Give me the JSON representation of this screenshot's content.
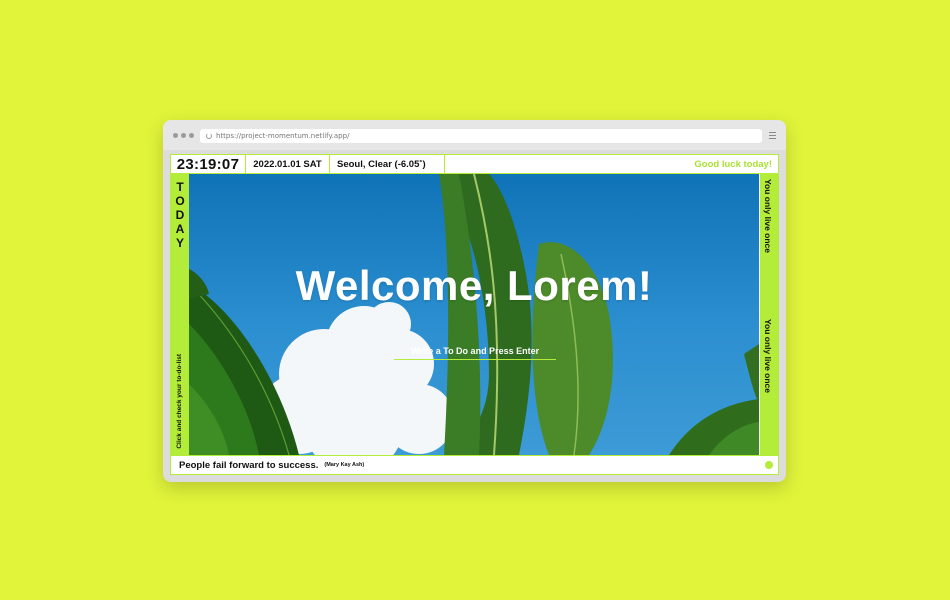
{
  "browser": {
    "url": "https://project-momentum.netlify.app/"
  },
  "topbar": {
    "clock": "23:19:07",
    "date": "2022.01.01 SAT",
    "weather": "Seoul, Clear (-6.05˚)",
    "greeting": "Good luck today!"
  },
  "left_sidebar": {
    "title_letters": [
      "T",
      "O",
      "D",
      "A",
      "Y"
    ],
    "hint": "Click and check your to-do-list"
  },
  "right_sidebar": {
    "motto_1": "You only live once",
    "motto_2": "You only live once"
  },
  "main": {
    "welcome": "Welcome, Lorem!",
    "todo_placeholder": "Write a To Do and Press Enter"
  },
  "bottombar": {
    "quote": "People fail forward to success.",
    "author": "(Mary Kay Ash)"
  },
  "colors": {
    "page_background": "#e1f43a",
    "accent": "#b4ec3a",
    "greeting": "#a8e232"
  },
  "icons": [
    "reload-icon",
    "menu-icon",
    "status-dot"
  ]
}
